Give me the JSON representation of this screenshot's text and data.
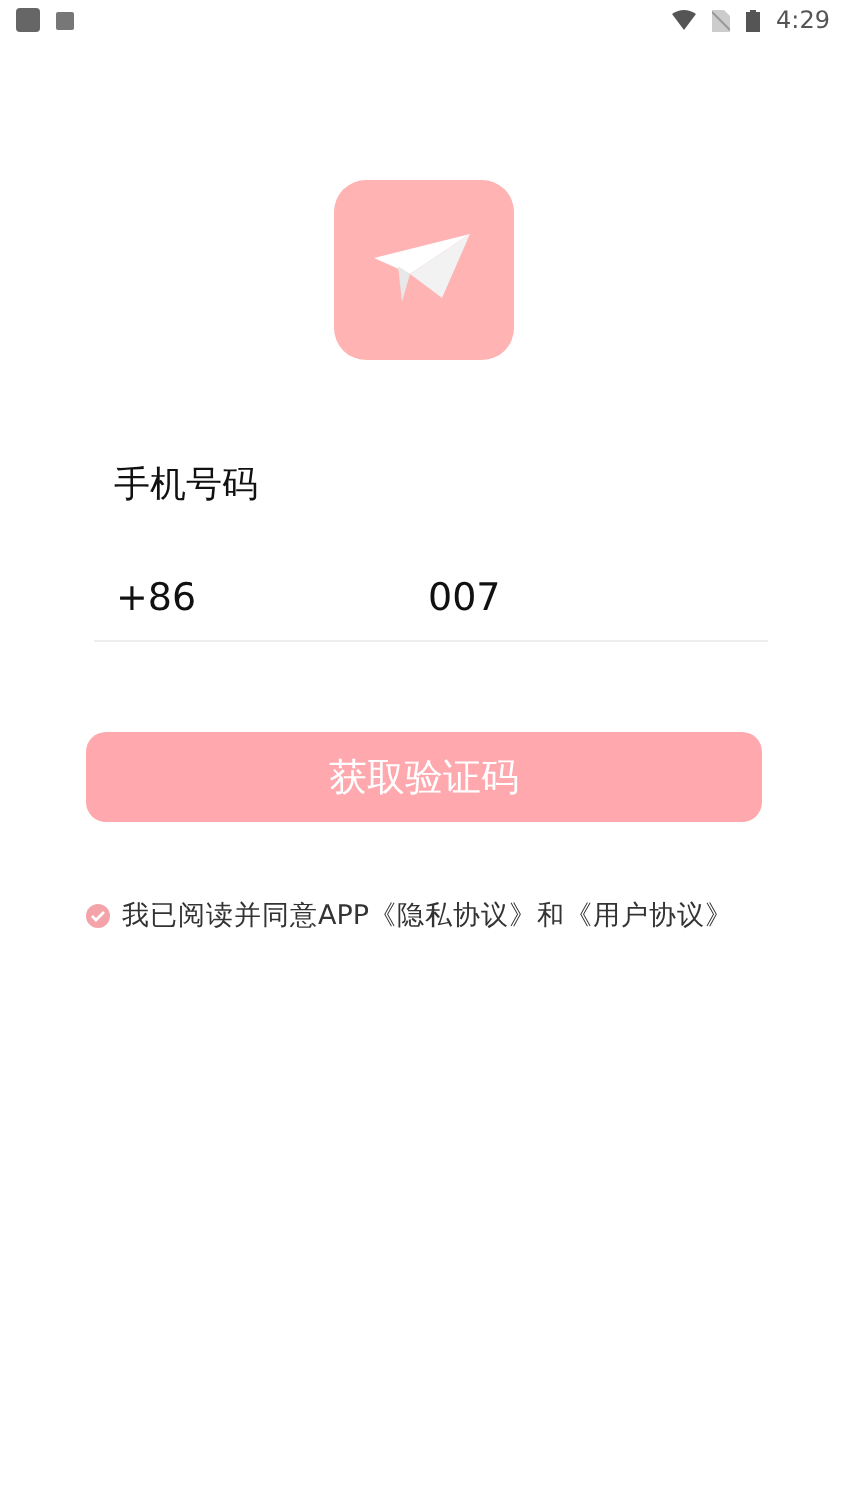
{
  "status_bar": {
    "time": "4:29"
  },
  "phone_label": "手机号码",
  "phone": {
    "prefix": "+86",
    "value": "007"
  },
  "submit_button": {
    "label": "获取验证码",
    "disabled": true
  },
  "agreement": {
    "checked": true,
    "text": "我已阅读并同意APP",
    "privacy_link": "《隐私协议》",
    "joiner": "和",
    "user_link": "《用户协议》"
  }
}
